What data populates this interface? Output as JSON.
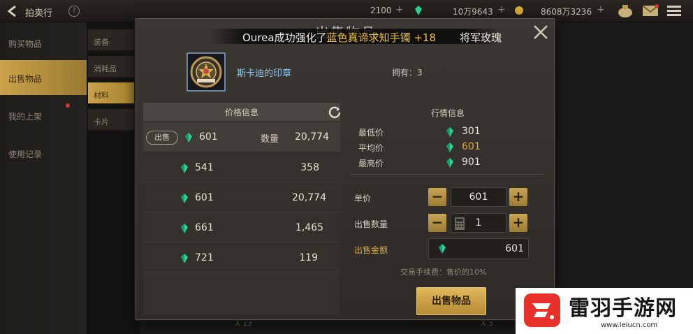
{
  "topbar": {
    "title": "拍卖行",
    "help": "?",
    "currencies": [
      {
        "icon": "moon-icon",
        "value": "2100"
      },
      {
        "icon": "gem-icon",
        "value": "10万9643"
      },
      {
        "icon": "gold-icon",
        "value": "8608万3236"
      }
    ],
    "plus": "+"
  },
  "sidebar": {
    "items": [
      {
        "label": "购买物品"
      },
      {
        "label": "出售物品"
      },
      {
        "label": "我的上架"
      },
      {
        "label": "使用记录"
      }
    ]
  },
  "subtabs": {
    "items": [
      {
        "label": "装备"
      },
      {
        "label": "消耗品"
      },
      {
        "label": "材料"
      },
      {
        "label": "卡片"
      }
    ]
  },
  "background_rows": {
    "labels": [
      "X 13",
      "X 3"
    ]
  },
  "modal": {
    "title": "出售物品",
    "marquee": {
      "prefix": "Ourea成功强化了",
      "highlight": "蓝色真谛求知手镯 +18",
      "suffix": "将军玫瑰、J"
    },
    "item": {
      "name": "斯卡迪的印章",
      "owned_label": "拥有：",
      "owned_value": "3"
    },
    "price_info": {
      "header": "价格信息",
      "sell_tag": "出售",
      "qty_label": "数量",
      "rows": [
        {
          "price": "601",
          "qty": "20,774"
        },
        {
          "price": "541",
          "qty": "358"
        },
        {
          "price": "601",
          "qty": "20,774"
        },
        {
          "price": "661",
          "qty": "1,465"
        },
        {
          "price": "721",
          "qty": "119"
        }
      ]
    },
    "market_info": {
      "header": "行情信息",
      "stats": [
        {
          "label": "最低价",
          "value": "301"
        },
        {
          "label": "平均价",
          "value": "601"
        },
        {
          "label": "最高价",
          "value": "901"
        }
      ]
    },
    "form": {
      "unit_price_label": "单价",
      "unit_price_value": "601",
      "quantity_label": "出售数量",
      "quantity_value": "1",
      "total_label": "出售金额",
      "total_value": "601",
      "minus": "−",
      "plus": "+",
      "fee_note": "交易手续费：售价的10%",
      "sell_button": "出售物品"
    }
  },
  "watermark": {
    "title": "雷羽手游网",
    "url": "www.leiucn.com"
  },
  "colors": {
    "accent_gold": "#c9a454",
    "gem_green": "#2fd39a",
    "item_name_blue": "#8ec8ee"
  }
}
